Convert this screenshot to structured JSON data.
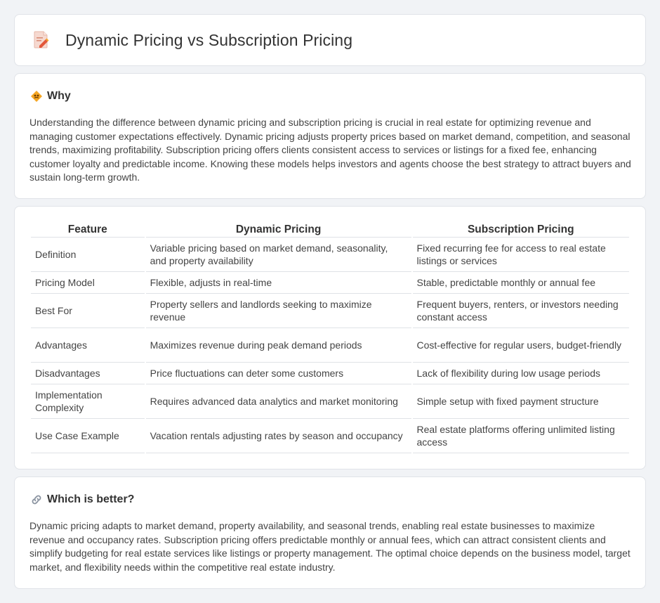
{
  "title": "Dynamic Pricing vs Subscription Pricing",
  "why": {
    "heading": "Why",
    "text": "Understanding the difference between dynamic pricing and subscription pricing is crucial in real estate for optimizing revenue and managing customer expectations effectively. Dynamic pricing adjusts property prices based on market demand, competition, and seasonal trends, maximizing profitability. Subscription pricing offers clients consistent access to services or listings for a fixed fee, enhancing customer loyalty and predictable income. Knowing these models helps investors and agents choose the best strategy to attract buyers and sustain long-term growth."
  },
  "table": {
    "headers": [
      "Feature",
      "Dynamic Pricing",
      "Subscription Pricing"
    ],
    "rows": [
      [
        "Definition",
        "Variable pricing based on market demand, seasonality, and property availability",
        "Fixed recurring fee for access to real estate listings or services"
      ],
      [
        "Pricing Model",
        "Flexible, adjusts in real-time",
        "Stable, predictable monthly or annual fee"
      ],
      [
        "Best For",
        "Property sellers and landlords seeking to maximize revenue",
        "Frequent buyers, renters, or investors needing constant access"
      ],
      [
        "Advantages",
        "Maximizes revenue during peak demand periods",
        "Cost-effective for regular users, budget-friendly"
      ],
      [
        "Disadvantages",
        "Price fluctuations can deter some customers",
        "Lack of flexibility during low usage periods"
      ],
      [
        "Implementation Complexity",
        "Requires advanced data analytics and market monitoring",
        "Simple setup with fixed payment structure"
      ],
      [
        "Use Case Example",
        "Vacation rentals adjusting rates by season and occupancy",
        "Real estate platforms offering unlimited listing access"
      ]
    ]
  },
  "better": {
    "heading": "Which is better?",
    "text": "Dynamic pricing adapts to market demand, property availability, and seasonal trends, enabling real estate businesses to maximize revenue and occupancy rates. Subscription pricing offers predictable monthly or annual fees, which can attract consistent clients and simplify budgeting for real estate services like listings or property management. The optimal choice depends on the business model, target market, and flexibility needs within the competitive real estate industry."
  },
  "icons": {
    "title": "document-pencil-icon",
    "why": "diamond-warning-icon",
    "better": "link-icon"
  },
  "colors": {
    "background": "#f1f3f6",
    "card": "#ffffff",
    "accent_orange": "#f5a623"
  }
}
